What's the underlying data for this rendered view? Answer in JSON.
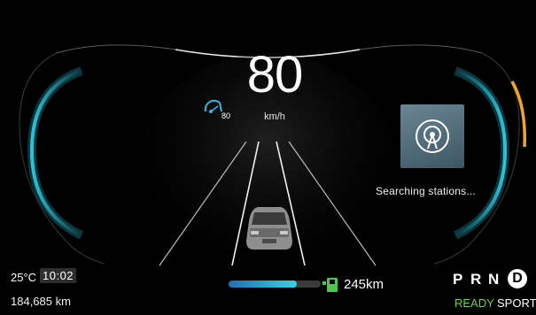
{
  "speed": {
    "value": "80",
    "unit": "km/h"
  },
  "speed_limit": {
    "value": "80",
    "icon": "speedometer-icon"
  },
  "radio": {
    "status": "Searching  stations...",
    "icon": "radio-antenna-icon"
  },
  "environment": {
    "temperature": "25°C",
    "time": "10:02"
  },
  "odometer": "184,685 km",
  "battery": {
    "range": "245km",
    "level_percent": 74,
    "icon": "charging-plug-icon"
  },
  "gears": {
    "p": "P",
    "r": "R",
    "n": "N",
    "d": "D",
    "selected": "D"
  },
  "drive_status": {
    "ready": "READY",
    "mode": "SPORT"
  },
  "colors": {
    "accent_cyan": "#3ad0e6",
    "ready_green": "#6ad23c",
    "speed_gauge_orange": "#f2a42b"
  }
}
